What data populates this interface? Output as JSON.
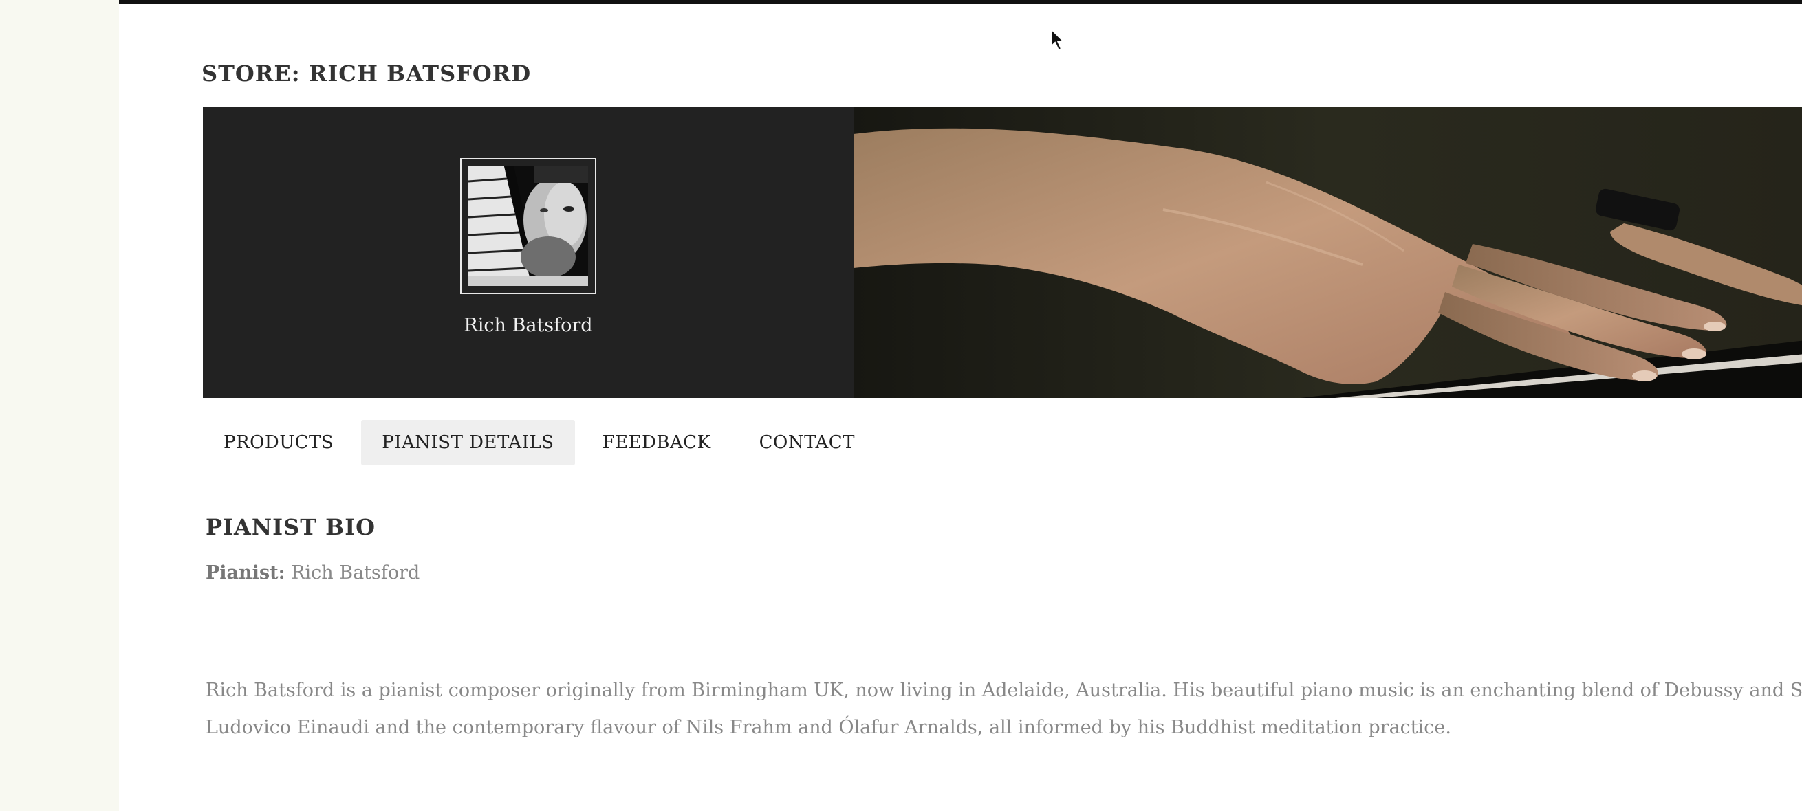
{
  "store": {
    "title": "STORE: RICH BATSFORD",
    "name": "Rich Batsford"
  },
  "tabs": [
    {
      "label": "PRODUCTS",
      "active": false
    },
    {
      "label": "PIANIST DETAILS",
      "active": true
    },
    {
      "label": "FEEDBACK",
      "active": false
    },
    {
      "label": "CONTACT",
      "active": false
    }
  ],
  "bio": {
    "heading": "PIANIST BIO",
    "pianist_label": "Pianist:",
    "pianist_value": "Rich Batsford",
    "lines": [
      "Rich Batsford is a pianist composer originally from Birmingham UK, now living in Adelaide, Australia. His beautiful piano music is an enchanting blend of Debussy and Satie sharin",
      "Ludovico Einaudi and the contemporary flavour of Nils Frahm and Ólafur Arnalds, all informed by his Buddhist meditation practice."
    ]
  },
  "colors": {
    "banner_bg": "#222222",
    "active_tab_bg": "#efefef",
    "page_bg": "#f8f9f1",
    "text_muted": "#888888"
  }
}
